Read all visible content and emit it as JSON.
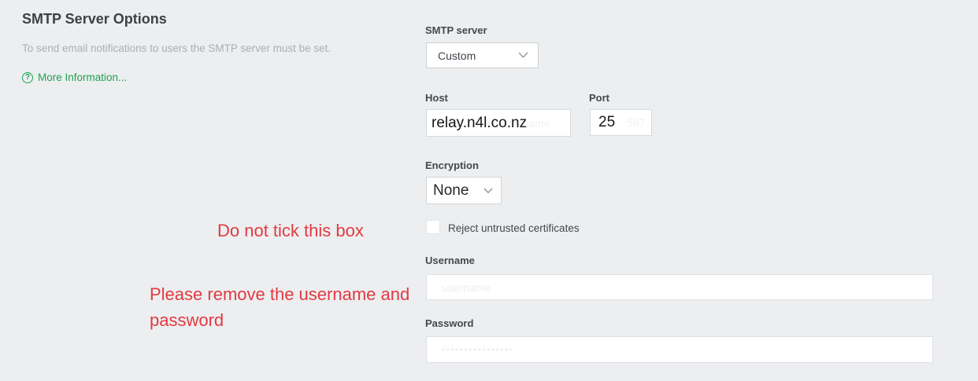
{
  "header": {
    "title": "SMTP Server Options",
    "subtitle": "To send email notifications to users the SMTP server must be set.",
    "more_info": "More Information..."
  },
  "form": {
    "smtp_server": {
      "label": "SMTP server",
      "value": "Custom"
    },
    "host": {
      "label": "Host",
      "value": "relay.n4l.co.nz",
      "placeholder": "smtp.server.hostname"
    },
    "port": {
      "label": "Port",
      "value": "25",
      "placeholder": "587"
    },
    "encryption": {
      "label": "Encryption",
      "value": "None"
    },
    "reject_certs": {
      "label": "Reject untrusted certificates",
      "checked": false
    },
    "username": {
      "label": "Username",
      "value": "",
      "placeholder": "username"
    },
    "password": {
      "label": "Password",
      "value": "",
      "placeholder": "••••••••••••••••"
    }
  },
  "annotations": {
    "checkbox_note": "Do not tick this box",
    "credentials_note": "Please remove the username and password"
  },
  "icons": {
    "help_glyph": "?"
  },
  "colors": {
    "background": "#eceef0",
    "accent_green": "#1fa351",
    "annotation_red": "#e23a40",
    "title_text": "#3c4247",
    "subtitle_text": "#a9b0b6",
    "label_text": "#42494e",
    "field_border": "#d8dbde",
    "field_bg": "#ffffff"
  }
}
